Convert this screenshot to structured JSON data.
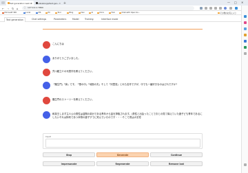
{
  "browser": {
    "tabs": [
      {
        "label": "Text generation web UI",
        "active": true,
        "favicon_color": "#e8ecf2"
      },
      {
        "label": "oobabooga/text-gen...",
        "active": false,
        "favicon_color": "#333333"
      }
    ],
    "new_tab_label": "+",
    "window_controls": {
      "minimize": "—",
      "maximize": "□",
      "close": "✕"
    },
    "url": "127.0.0.1:7860",
    "bookmarks": [
      {
        "label": "Microsoft 365",
        "color": "#e06030"
      },
      {
        "label": "Local",
        "color": "#3a78d8"
      },
      {
        "label": "MS",
        "color": "#3a78d8"
      },
      {
        "label": "PC",
        "color": "#f0a030"
      },
      {
        "label": "Tool",
        "color": "#f0a030"
      },
      {
        "label": "Blog",
        "color": "#f0a030"
      },
      {
        "label": "Dev",
        "color": "#f0a030"
      },
      {
        "label": "AI",
        "color": "#f0a030"
      },
      {
        "label": "Docs",
        "color": "#f0a030"
      },
      {
        "label": "Hub",
        "color": "#f0a030"
      },
      {
        "label": "Chat with Open So...",
        "color": "#f0a030"
      },
      {
        "label": "その他のお気に入り",
        "color": "#f0a030"
      }
    ]
  },
  "app": {
    "tabs": [
      "Text generation",
      "Chat settings",
      "Parameters",
      "Model",
      "Training",
      "Interface mode"
    ],
    "active_tab": "Text generation",
    "messages": [
      {
        "role": "bot",
        "text": "こんにちは"
      },
      {
        "role": "user",
        "text": "ありがとうございました。"
      },
      {
        "role": "bot",
        "text": "芥川龍之介の代表作を教えてください。"
      },
      {
        "role": "user",
        "text": "「羅生門」「鼻」です。「葦の中」「地獄の夫」そして「河童変」とれも名作ですが、中でも一番好きなのはどれですか?"
      },
      {
        "role": "bot",
        "text": "羅生門のストーリーを教えてください。"
      },
      {
        "role": "user",
        "text": "和泉王しまず主人公の男性は盗賊の弟分である青年から金を搾取されます。(男性と出会ったことでおとの見て構えていた妻子ども青年であるにしたいそれは財布であつ本物の妻子すでに死んでいたのです・・・そこで書は大を短"
      }
    ],
    "input": {
      "label": "Input",
      "value": ""
    },
    "buttons": {
      "row1": [
        "Stop",
        "Generate",
        "Continue"
      ],
      "row2": [
        "Impersonate",
        "Regenerate",
        "Remove last"
      ]
    },
    "accent_color": "#f3a05a"
  }
}
